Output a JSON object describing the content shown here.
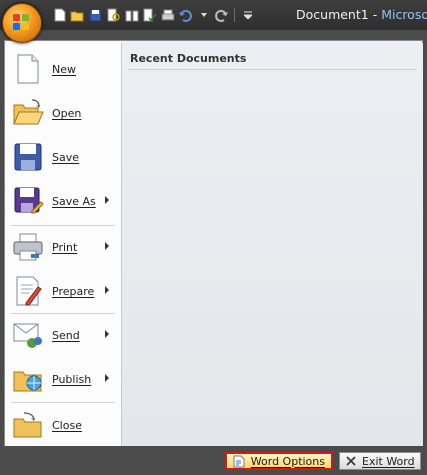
{
  "window": {
    "document_name": "Document1",
    "separator": " - ",
    "app_name": "Microsof"
  },
  "quick_access": [
    "new-icon",
    "open-icon",
    "save-icon",
    "print-preview-icon",
    "reading-icon",
    "spelling-icon",
    "print-icon",
    "undo-icon",
    "redo-icon",
    "customize-icon"
  ],
  "menu": {
    "items": [
      {
        "label": "New",
        "has_submenu": false
      },
      {
        "label": "Open",
        "has_submenu": false
      },
      {
        "label": "Save",
        "has_submenu": false
      },
      {
        "label": "Save As",
        "has_submenu": true
      },
      {
        "label": "Print",
        "has_submenu": true
      },
      {
        "label": "Prepare",
        "has_submenu": true
      },
      {
        "label": "Send",
        "has_submenu": true
      },
      {
        "label": "Publish",
        "has_submenu": true
      },
      {
        "label": "Close",
        "has_submenu": false
      }
    ],
    "recent_title": "Recent Documents"
  },
  "footer": {
    "word_options": "Word Options",
    "exit_word": "Exit Word"
  },
  "colors": {
    "highlight_border": "#d21a1a",
    "orb": "#f39a1b",
    "title_accent": "#8fc2ff"
  }
}
